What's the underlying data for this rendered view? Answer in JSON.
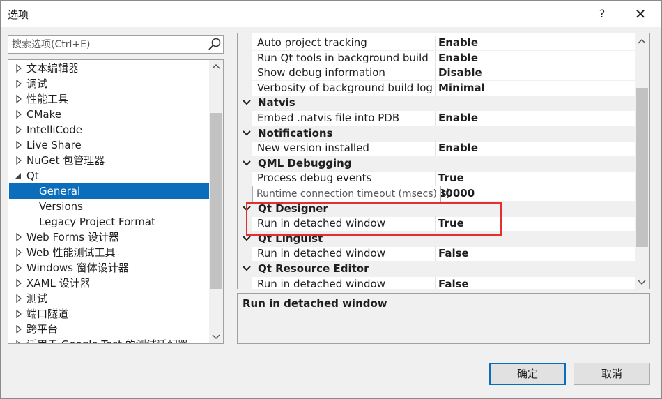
{
  "window": {
    "title": "选项",
    "help": "?",
    "close": "✕"
  },
  "search": {
    "placeholder": "搜索选项(Ctrl+E)"
  },
  "tree": {
    "items": [
      {
        "label": "文本编辑器",
        "arrow": "collapsed"
      },
      {
        "label": "调试",
        "arrow": "collapsed"
      },
      {
        "label": "性能工具",
        "arrow": "collapsed"
      },
      {
        "label": "CMake",
        "arrow": "collapsed"
      },
      {
        "label": "IntelliCode",
        "arrow": "collapsed"
      },
      {
        "label": "Live Share",
        "arrow": "collapsed"
      },
      {
        "label": "NuGet 包管理器",
        "arrow": "collapsed"
      },
      {
        "label": "Qt",
        "arrow": "expanded"
      },
      {
        "label": "General",
        "arrow": "none",
        "selected": true
      },
      {
        "label": "Versions",
        "arrow": "none"
      },
      {
        "label": "Legacy Project Format",
        "arrow": "none"
      },
      {
        "label": "Web Forms 设计器",
        "arrow": "collapsed"
      },
      {
        "label": "Web 性能测试工具",
        "arrow": "collapsed"
      },
      {
        "label": "Windows 窗体设计器",
        "arrow": "collapsed"
      },
      {
        "label": "XAML 设计器",
        "arrow": "collapsed"
      },
      {
        "label": "测试",
        "arrow": "collapsed"
      },
      {
        "label": "端口隧道",
        "arrow": "collapsed"
      },
      {
        "label": "跨平台",
        "arrow": "collapsed"
      },
      {
        "label": "适用于 Google Test 的测试适配器",
        "arrow": "collapsed"
      }
    ]
  },
  "grid": {
    "rows": [
      {
        "type": "prop",
        "name": "Auto project tracking",
        "value": "Enable"
      },
      {
        "type": "prop",
        "name": "Run Qt tools in background build",
        "value": "Enable"
      },
      {
        "type": "prop",
        "name": "Show debug information",
        "value": "Disable"
      },
      {
        "type": "prop",
        "name": "Verbosity of background build log",
        "value": "Minimal"
      },
      {
        "type": "cat",
        "name": "Natvis"
      },
      {
        "type": "prop",
        "name": "Embed .natvis file into PDB",
        "value": "Enable"
      },
      {
        "type": "cat",
        "name": "Notifications"
      },
      {
        "type": "prop",
        "name": "New version installed",
        "value": "Enable"
      },
      {
        "type": "cat",
        "name": "QML Debugging"
      },
      {
        "type": "prop",
        "name": "Process debug events",
        "value": "True"
      },
      {
        "type": "prop",
        "name": "Runtime connection timeout (msecs)",
        "value": "30000"
      },
      {
        "type": "cat",
        "name": "Qt Designer"
      },
      {
        "type": "prop",
        "name": "Run in detached window",
        "value": "True"
      },
      {
        "type": "cat",
        "name": "Qt Linguist"
      },
      {
        "type": "prop",
        "name": "Run in detached window",
        "value": "False"
      },
      {
        "type": "cat",
        "name": "Qt Resource Editor"
      },
      {
        "type": "prop",
        "name": "Run in detached window",
        "value": "False"
      }
    ]
  },
  "tooltip": {
    "text": "Runtime connection timeout (msecs)"
  },
  "description": {
    "title": "Run in detached window"
  },
  "buttons": {
    "ok": "确定",
    "cancel": "取消"
  },
  "colors": {
    "selection": "#0a6ebd",
    "highlight_box": "#e0312f"
  }
}
